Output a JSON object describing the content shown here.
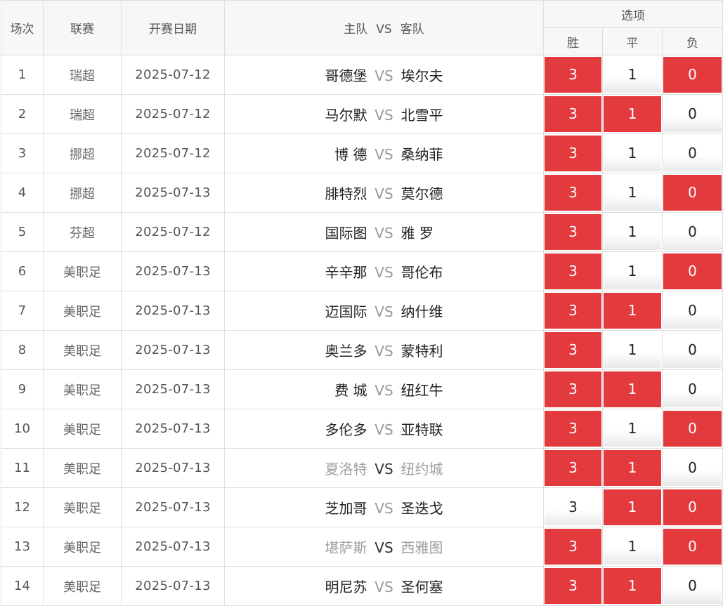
{
  "headers": {
    "index": "场次",
    "league": "联赛",
    "date": "开赛日期",
    "home": "主队",
    "vs": "VS",
    "away": "客队",
    "options": "选项",
    "win": "胜",
    "draw": "平",
    "loss": "负"
  },
  "colors": {
    "selected": "#e23a3d",
    "border": "#dedede",
    "header_bg": "#f7f7f7"
  },
  "rows": [
    {
      "no": "1",
      "league": "瑞超",
      "date": "2025-07-12",
      "home": "哥德堡",
      "vs": "VS",
      "away": "埃尔夫",
      "muted": false,
      "win": "3",
      "draw": "1",
      "loss": "0",
      "sel": [
        true,
        false,
        true
      ]
    },
    {
      "no": "2",
      "league": "瑞超",
      "date": "2025-07-12",
      "home": "马尔默",
      "vs": "VS",
      "away": "北雪平",
      "muted": false,
      "win": "3",
      "draw": "1",
      "loss": "0",
      "sel": [
        true,
        true,
        false
      ]
    },
    {
      "no": "3",
      "league": "挪超",
      "date": "2025-07-12",
      "home": "博 德",
      "vs": "VS",
      "away": "桑纳菲",
      "muted": false,
      "win": "3",
      "draw": "1",
      "loss": "0",
      "sel": [
        true,
        false,
        false
      ]
    },
    {
      "no": "4",
      "league": "挪超",
      "date": "2025-07-13",
      "home": "腓特烈",
      "vs": "VS",
      "away": "莫尔德",
      "muted": false,
      "win": "3",
      "draw": "1",
      "loss": "0",
      "sel": [
        true,
        false,
        true
      ]
    },
    {
      "no": "5",
      "league": "芬超",
      "date": "2025-07-12",
      "home": "国际图",
      "vs": "VS",
      "away": "雅 罗",
      "muted": false,
      "win": "3",
      "draw": "1",
      "loss": "0",
      "sel": [
        true,
        false,
        false
      ]
    },
    {
      "no": "6",
      "league": "美职足",
      "date": "2025-07-13",
      "home": "辛辛那",
      "vs": "VS",
      "away": "哥伦布",
      "muted": false,
      "win": "3",
      "draw": "1",
      "loss": "0",
      "sel": [
        true,
        false,
        true
      ]
    },
    {
      "no": "7",
      "league": "美职足",
      "date": "2025-07-13",
      "home": "迈国际",
      "vs": "VS",
      "away": "纳什维",
      "muted": false,
      "win": "3",
      "draw": "1",
      "loss": "0",
      "sel": [
        true,
        true,
        false
      ]
    },
    {
      "no": "8",
      "league": "美职足",
      "date": "2025-07-13",
      "home": "奥兰多",
      "vs": "VS",
      "away": "蒙特利",
      "muted": false,
      "win": "3",
      "draw": "1",
      "loss": "0",
      "sel": [
        true,
        false,
        false
      ]
    },
    {
      "no": "9",
      "league": "美职足",
      "date": "2025-07-13",
      "home": "费 城",
      "vs": "VS",
      "away": "纽红牛",
      "muted": false,
      "win": "3",
      "draw": "1",
      "loss": "0",
      "sel": [
        true,
        true,
        false
      ]
    },
    {
      "no": "10",
      "league": "美职足",
      "date": "2025-07-13",
      "home": "多伦多",
      "vs": "VS",
      "away": "亚特联",
      "muted": false,
      "win": "3",
      "draw": "1",
      "loss": "0",
      "sel": [
        true,
        false,
        true
      ]
    },
    {
      "no": "11",
      "league": "美职足",
      "date": "2025-07-13",
      "home": "夏洛特",
      "vs": "VS",
      "away": "纽约城",
      "muted": true,
      "win": "3",
      "draw": "1",
      "loss": "0",
      "sel": [
        true,
        true,
        false
      ]
    },
    {
      "no": "12",
      "league": "美职足",
      "date": "2025-07-13",
      "home": "芝加哥",
      "vs": "VS",
      "away": "圣迭戈",
      "muted": false,
      "win": "3",
      "draw": "1",
      "loss": "0",
      "sel": [
        false,
        true,
        true
      ]
    },
    {
      "no": "13",
      "league": "美职足",
      "date": "2025-07-13",
      "home": "堪萨斯",
      "vs": "VS",
      "away": "西雅图",
      "muted": true,
      "win": "3",
      "draw": "1",
      "loss": "0",
      "sel": [
        true,
        false,
        true
      ]
    },
    {
      "no": "14",
      "league": "美职足",
      "date": "2025-07-13",
      "home": "明尼苏",
      "vs": "VS",
      "away": "圣何塞",
      "muted": false,
      "win": "3",
      "draw": "1",
      "loss": "0",
      "sel": [
        true,
        true,
        false
      ]
    }
  ]
}
